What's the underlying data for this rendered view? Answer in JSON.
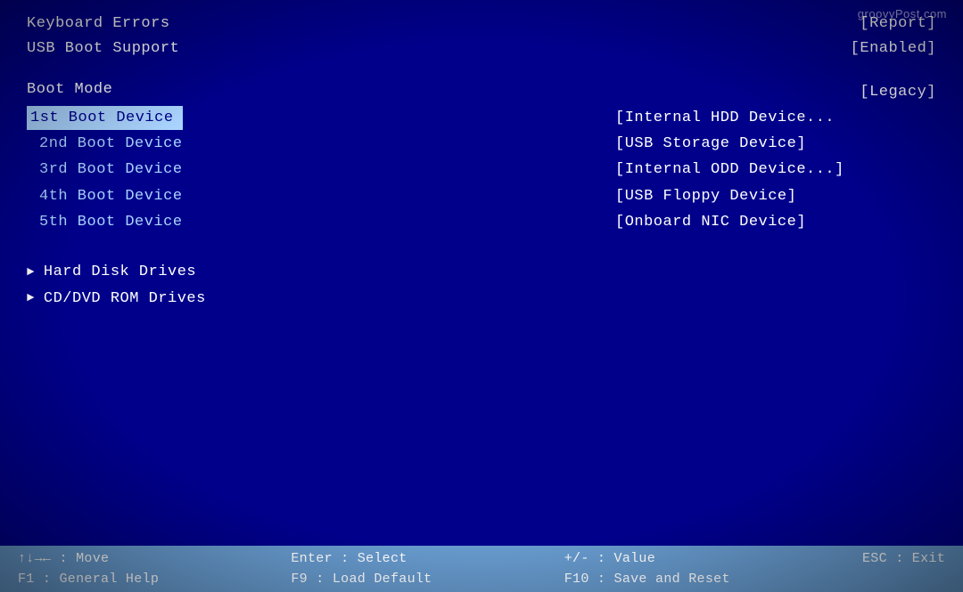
{
  "watermark": "groovyPost.com",
  "top_section": {
    "rows": [
      {
        "label": "Keyboard Errors",
        "value": "[Report]"
      },
      {
        "label": "USB Boot Support",
        "value": "[Enabled]"
      }
    ]
  },
  "boot_mode": {
    "label": "Boot Mode",
    "value": "[Legacy]"
  },
  "boot_devices": [
    {
      "label": "1st Boot Device",
      "value": "[Internal HDD Device..."
    },
    {
      "label": "2nd Boot Device",
      "value": "[USB Storage Device]"
    },
    {
      "label": "3rd Boot Device",
      "value": "[Internal ODD Device...]"
    },
    {
      "label": "4th Boot Device",
      "value": "[USB Floppy Device]"
    },
    {
      "label": "5th Boot Device",
      "value": "[Onboard NIC Device]"
    }
  ],
  "submenu_items": [
    {
      "label": "Hard Disk Drives"
    },
    {
      "label": "CD/DVD ROM Drives"
    }
  ],
  "bottom_bar": {
    "col1_line1": "↑↓→← : Move",
    "col1_line2": "F1 : General Help",
    "col2_line1": "Enter : Select",
    "col2_line2": "F9 : Load Default",
    "col3_line1": "+/- : Value",
    "col3_line2": "F10 : Save and Reset",
    "col4_line1": "ESC : Exit",
    "col4_line2": ""
  }
}
